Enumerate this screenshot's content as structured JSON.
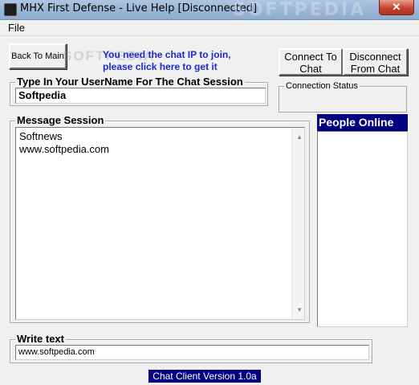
{
  "window": {
    "title": "MHX First Defense - Live Help [Disconnected]",
    "title_watermark": "SOFTPEDIA",
    "close_glyph": "✕"
  },
  "menu": {
    "items": [
      {
        "label": "File"
      }
    ]
  },
  "toolbar": {
    "back_label": "Back To Main",
    "chat_ip_line1": "You need the chat IP to join,",
    "chat_ip_line2": "please click here to get it",
    "watermark": "SOFTPEDIA",
    "connect_line1": "Connect To",
    "connect_line2": "Chat",
    "disconnect_line1": "Disconnect",
    "disconnect_line2": "From Chat"
  },
  "username": {
    "title": "Type In Your UserName For The Chat Session",
    "value": "Softpedia"
  },
  "status": {
    "title": "Connection Status",
    "value": ""
  },
  "message": {
    "title": "Message Session",
    "lines": [
      "Softnews",
      "www.softpedia.com"
    ]
  },
  "people": {
    "title": "People Online",
    "items": []
  },
  "write": {
    "title": "Write text",
    "value": "www.softpedia.com"
  },
  "footer": {
    "version": "Chat Client Version 1.0a"
  },
  "colors": {
    "header_bg": "#000080",
    "link": "#1a2ad6",
    "close_btn": "#c7422e"
  },
  "icons": {
    "app": "app-icon",
    "scroll_up": "scroll-up-arrow-icon",
    "scroll_down": "scroll-down-arrow-icon"
  }
}
